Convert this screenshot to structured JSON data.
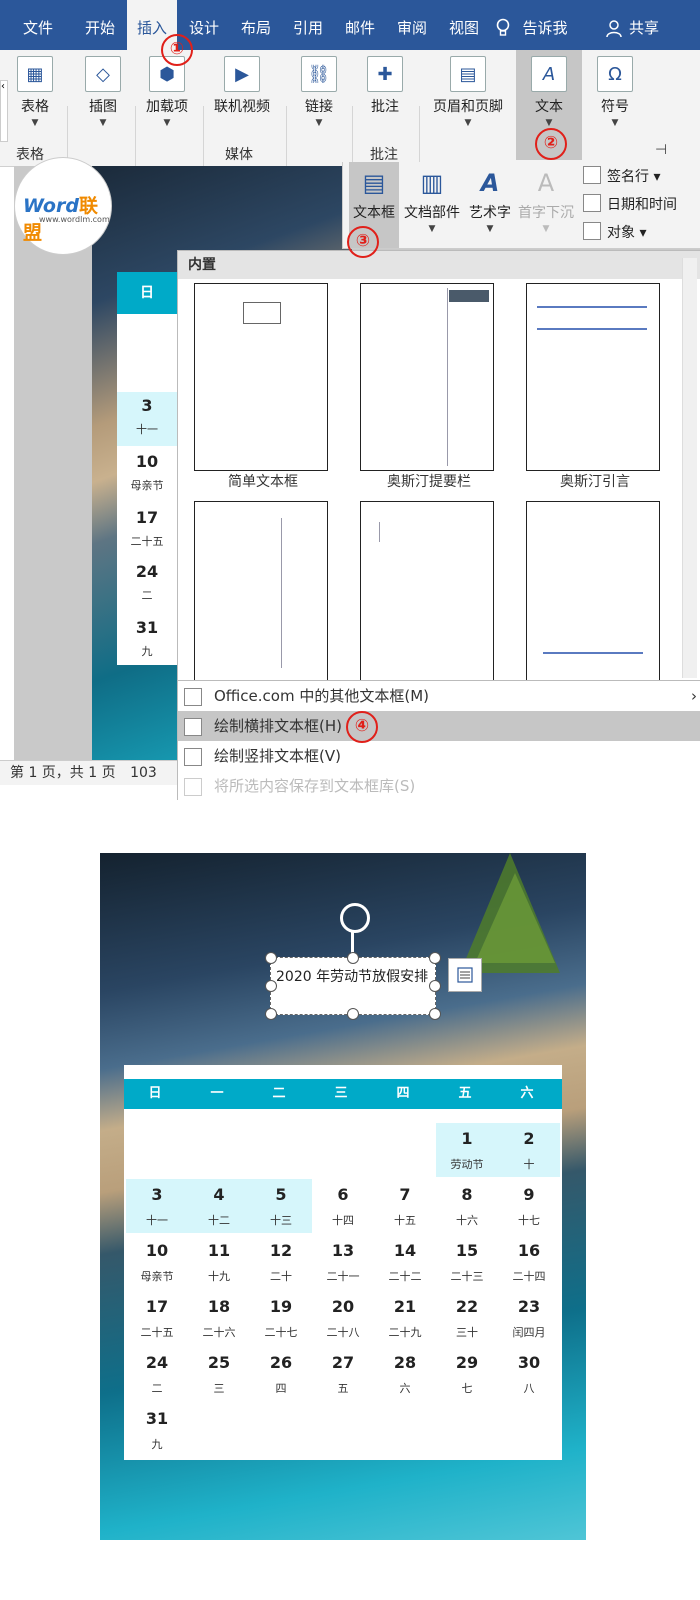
{
  "ribbon": {
    "tabs": [
      "文件",
      "开始",
      "插入",
      "设计",
      "布局",
      "引用",
      "邮件",
      "审阅",
      "视图",
      "告诉我",
      "共享"
    ],
    "buttons": {
      "table": "表格",
      "illustrations": "插图",
      "addins": "加载项",
      "online_video": "联机视频",
      "link": "链接",
      "comment": "批注",
      "header_footer": "页眉和页脚",
      "text": "文本",
      "symbol": "符号"
    },
    "groups": {
      "table": "表格",
      "media": "媒体",
      "comment": "批注"
    }
  },
  "steps": [
    "①",
    "②",
    "③",
    "④"
  ],
  "logo": {
    "brand": "Word",
    "brand_cn": "联盟",
    "url": "www.wordlm.com"
  },
  "text_panel": {
    "textbox": "文本框",
    "quick_parts": "文档部件",
    "wordart": "艺术字",
    "drop_cap": "首字下沉",
    "signature_line": "签名行",
    "date_time": "日期和时间",
    "object": "对象"
  },
  "gallery": {
    "header": "内置",
    "thumbs": [
      "简单文本框",
      "奥斯汀提要栏",
      "奥斯汀引言"
    ]
  },
  "menu": {
    "more_textboxes": "Office.com 中的其他文本框(M)",
    "draw_horizontal": "绘制横排文本框(H)",
    "draw_vertical": "绘制竖排文本框(V)",
    "save_selection": "将所选内容保存到文本框库(S)"
  },
  "status": {
    "page_info": "第 1 页，共 1 页",
    "word_count": "103"
  },
  "mini_calendar": {
    "header": "日",
    "cells": [
      {
        "n": "3",
        "l": "十一"
      },
      {
        "n": "10",
        "l": "母亲节"
      },
      {
        "n": "17",
        "l": "二十五"
      },
      {
        "n": "24",
        "l": "二"
      },
      {
        "n": "31",
        "l": "九"
      }
    ]
  },
  "textbox_text": "2020 年劳动节放假安排",
  "calendar": {
    "weekdays": [
      "日",
      "一",
      "二",
      "三",
      "四",
      "五",
      "六"
    ],
    "weeks": [
      [
        null,
        null,
        null,
        null,
        null,
        {
          "n": "1",
          "l": "劳动节",
          "hl": true
        },
        {
          "n": "2",
          "l": "十",
          "hl": true
        }
      ],
      [
        {
          "n": "3",
          "l": "十一",
          "hl": true
        },
        {
          "n": "4",
          "l": "十二",
          "hl": true
        },
        {
          "n": "5",
          "l": "十三",
          "hl": true
        },
        {
          "n": "6",
          "l": "十四"
        },
        {
          "n": "7",
          "l": "十五"
        },
        {
          "n": "8",
          "l": "十六"
        },
        {
          "n": "9",
          "l": "十七"
        }
      ],
      [
        {
          "n": "10",
          "l": "母亲节"
        },
        {
          "n": "11",
          "l": "十九"
        },
        {
          "n": "12",
          "l": "二十"
        },
        {
          "n": "13",
          "l": "二十一"
        },
        {
          "n": "14",
          "l": "二十二"
        },
        {
          "n": "15",
          "l": "二十三"
        },
        {
          "n": "16",
          "l": "二十四"
        }
      ],
      [
        {
          "n": "17",
          "l": "二十五"
        },
        {
          "n": "18",
          "l": "二十六"
        },
        {
          "n": "19",
          "l": "二十七"
        },
        {
          "n": "20",
          "l": "二十八"
        },
        {
          "n": "21",
          "l": "二十九"
        },
        {
          "n": "22",
          "l": "三十"
        },
        {
          "n": "23",
          "l": "闰四月"
        }
      ],
      [
        {
          "n": "24",
          "l": "二"
        },
        {
          "n": "25",
          "l": "三"
        },
        {
          "n": "26",
          "l": "四"
        },
        {
          "n": "27",
          "l": "五"
        },
        {
          "n": "28",
          "l": "六"
        },
        {
          "n": "29",
          "l": "七"
        },
        {
          "n": "30",
          "l": "八"
        }
      ],
      [
        {
          "n": "31",
          "l": "九"
        },
        null,
        null,
        null,
        null,
        null,
        null
      ]
    ]
  }
}
